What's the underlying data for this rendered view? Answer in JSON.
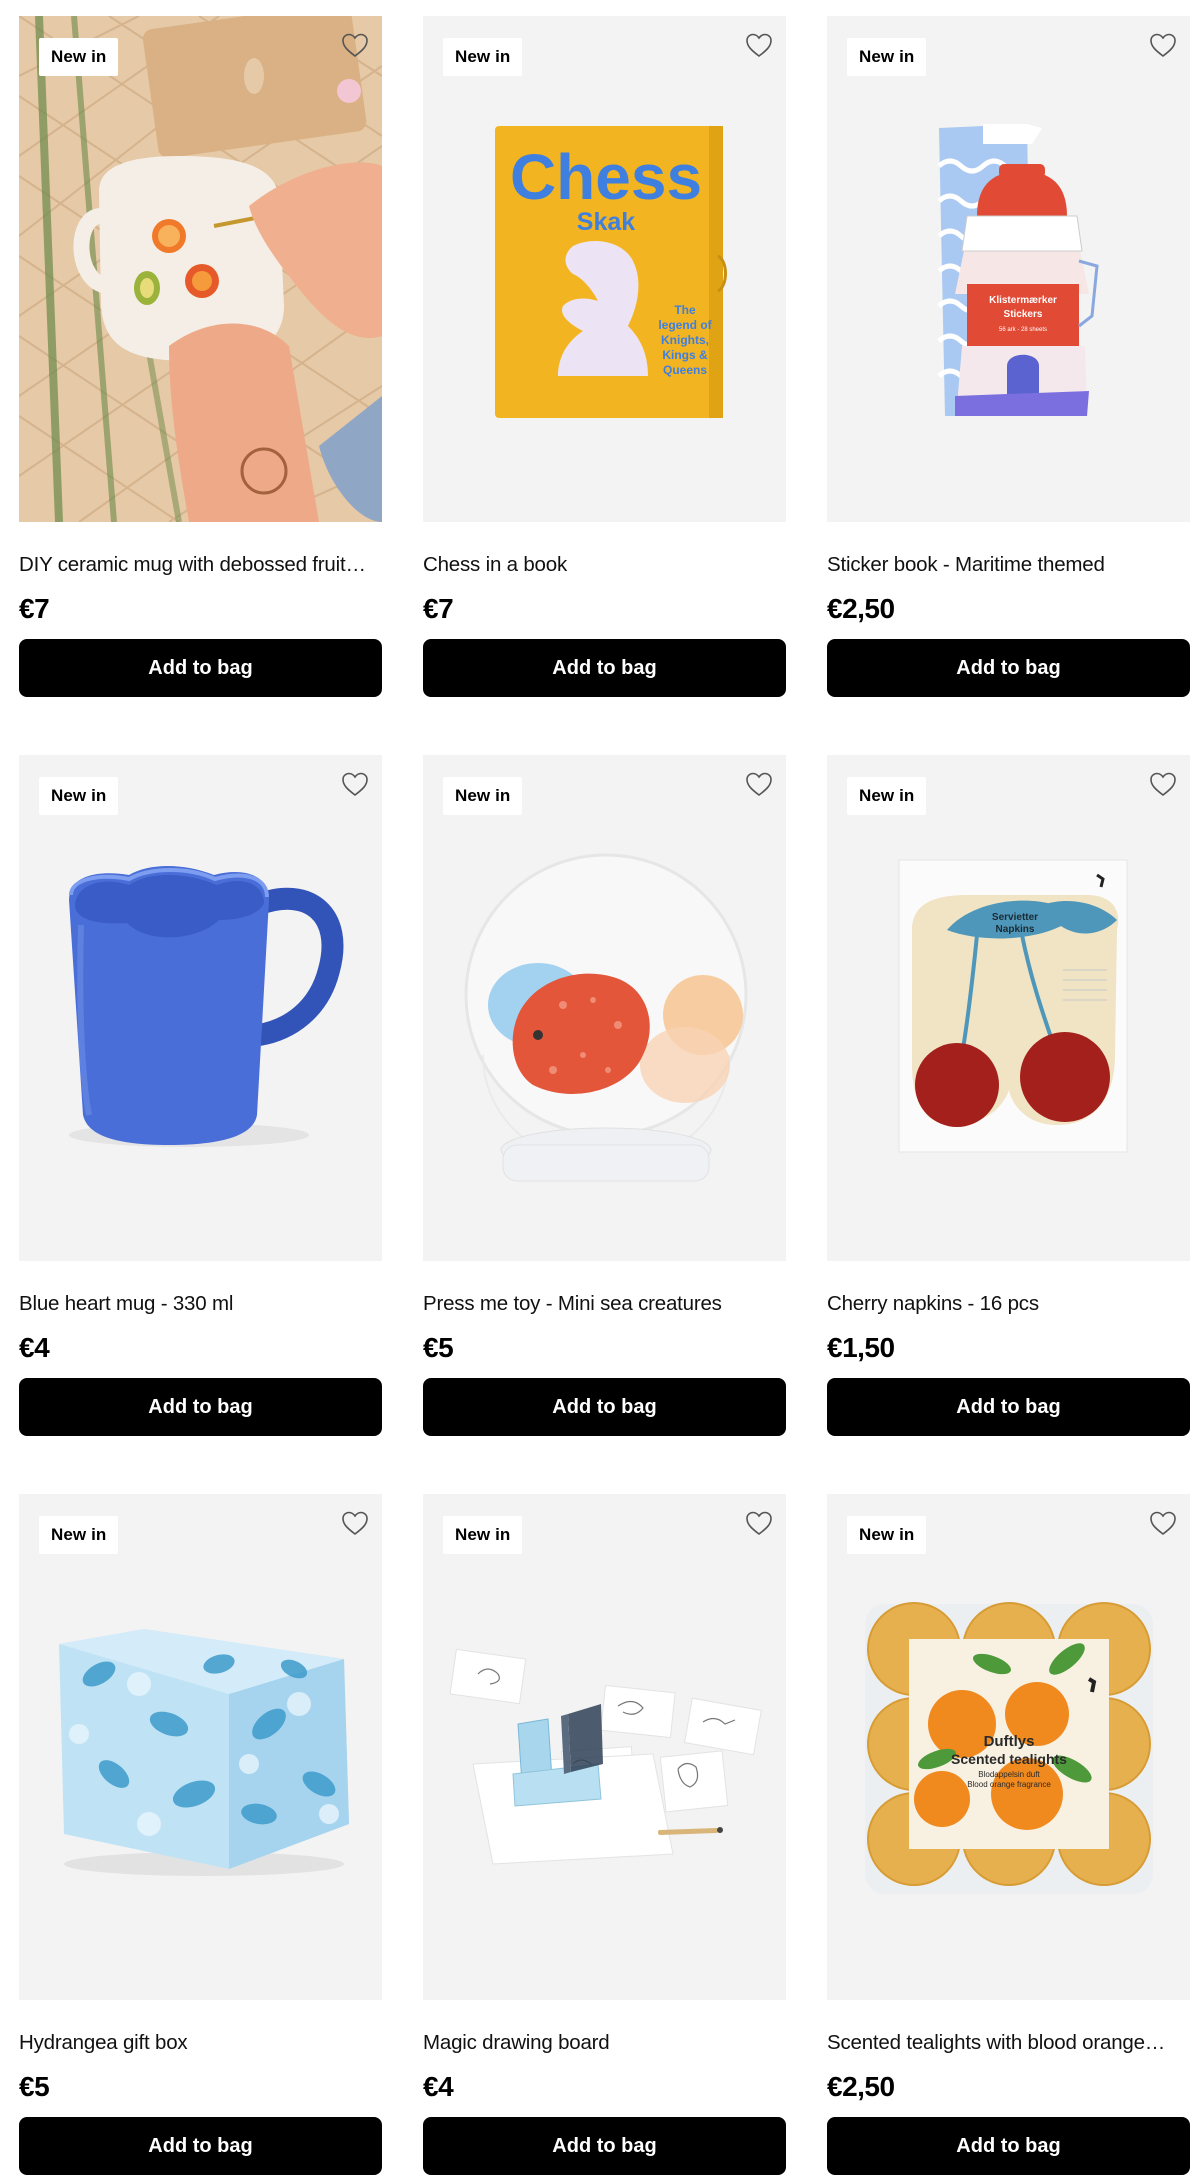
{
  "products": [
    {
      "badge": "New in",
      "name": "DIY ceramic mug with debossed fruit…",
      "price": "€7",
      "button": "Add to bag",
      "image": "diy-ceramic-mug"
    },
    {
      "badge": "New in",
      "name": "Chess in a book",
      "price": "€7",
      "button": "Add to bag",
      "image": "chess-book",
      "image_text": {
        "title": "Chess",
        "subtitle": "Skak",
        "blurb": [
          "The",
          "legend of",
          "Knights,",
          "Kings &",
          "Queens"
        ]
      }
    },
    {
      "badge": "New in",
      "name": "Sticker book - Maritime themed",
      "price": "€2,50",
      "button": "Add to bag",
      "image": "sticker-book",
      "image_text": {
        "line1": "Klistermærker",
        "line2": "Stickers",
        "line3": "56 ark - 28 sheets"
      }
    },
    {
      "badge": "New in",
      "name": "Blue heart mug - 330 ml",
      "price": "€4",
      "button": "Add to bag",
      "image": "blue-heart-mug"
    },
    {
      "badge": "New in",
      "name": "Press me toy - Mini sea creatures",
      "price": "€5",
      "button": "Add to bag",
      "image": "press-me-toy"
    },
    {
      "badge": "New in",
      "name": "Cherry napkins - 16 pcs",
      "price": "€1,50",
      "button": "Add to bag",
      "image": "cherry-napkins",
      "image_text": {
        "line1": "Servietter",
        "line2": "Napkins"
      }
    },
    {
      "badge": "New in",
      "name": "Hydrangea gift box",
      "price": "€5",
      "button": "Add to bag",
      "image": "hydrangea-gift-box"
    },
    {
      "badge": "New in",
      "name": "Magic drawing board",
      "price": "€4",
      "button": "Add to bag",
      "image": "magic-drawing-board"
    },
    {
      "badge": "New in",
      "name": "Scented tealights with blood orange…",
      "price": "€2,50",
      "button": "Add to bag",
      "image": "scented-tealights",
      "image_text": {
        "line1": "Duftlys",
        "line2": "Scented tealights",
        "line3": "Blodappelsin duft",
        "line4": "Blood orange fragrance"
      }
    }
  ],
  "icons": {
    "favorite": "heart-outline-icon"
  },
  "colors": {
    "button_bg": "#000000",
    "button_text": "#ffffff",
    "image_bg": "#f3f3f3"
  }
}
